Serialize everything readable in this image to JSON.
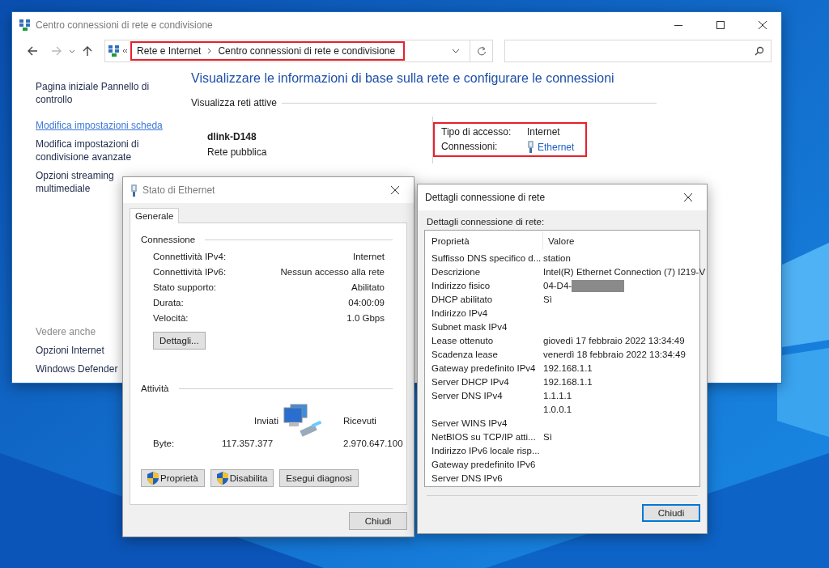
{
  "main_window": {
    "title": "Centro connessioni di rete e condivisione",
    "address": {
      "breadcrumb": [
        "Rete e Internet",
        "Centro connessioni di rete e condivisione"
      ],
      "highlighted": true
    },
    "sidebar": {
      "links": [
        {
          "label": "Pagina iniziale Pannello di controllo",
          "hovered": false
        },
        {
          "label": "Modifica impostazioni scheda",
          "hovered": true
        },
        {
          "label": "Modifica impostazioni di condivisione avanzate",
          "hovered": false
        },
        {
          "label": "Opzioni streaming multimediale",
          "hovered": false
        }
      ],
      "see_also": {
        "heading": "Vedere anche",
        "links": [
          "Opzioni Internet",
          "Windows Defender"
        ]
      }
    },
    "heading": "Visualizzare le informazioni di base sulla rete e configurare le connessioni",
    "section": "Visualizza reti attive",
    "network": {
      "name": "dlink-D148",
      "type": "Rete pubblica"
    },
    "access": {
      "highlighted": true,
      "rows": [
        {
          "label": "Tipo di accesso:",
          "value": "Internet",
          "kind": "text"
        },
        {
          "label": "Connessioni:",
          "value": "Ethernet",
          "kind": "link"
        }
      ]
    }
  },
  "status_dialog": {
    "title": "Stato di Ethernet",
    "tabs": [
      {
        "label": "Generale",
        "selected": true
      }
    ],
    "connection": {
      "heading": "Connessione",
      "rows": [
        {
          "label": "Connettività IPv4:",
          "value": "Internet"
        },
        {
          "label": "Connettività IPv6:",
          "value": "Nessun accesso alla rete"
        },
        {
          "label": "Stato supporto:",
          "value": "Abilitato"
        },
        {
          "label": "Durata:",
          "value": "04:00:09"
        },
        {
          "label": "Velocità:",
          "value": "1.0 Gbps"
        }
      ],
      "details_button": "Dettagli..."
    },
    "activity": {
      "heading": "Attività",
      "sent_label": "Inviati",
      "received_label": "Ricevuti",
      "bytes_label": "Byte:",
      "sent": "117.357.377",
      "received": "2.970.647.100"
    },
    "buttons": [
      {
        "label": "Proprietà",
        "shield": true
      },
      {
        "label": "Disabilita",
        "shield": true
      },
      {
        "label": "Esegui diagnosi",
        "shield": false
      }
    ],
    "close_button": {
      "label": "Chiudi",
      "focused": false
    }
  },
  "details_dialog": {
    "title": "Dettagli connessione di rete",
    "caption": "Dettagli connessione di rete:",
    "columns": [
      "Proprietà",
      "Valore"
    ],
    "rows": [
      {
        "property": "Suffisso DNS specifico d...",
        "value": "station",
        "redacted": false
      },
      {
        "property": "Descrizione",
        "value": "Intel(R) Ethernet Connection (7) I219-V",
        "redacted": false
      },
      {
        "property": "Indirizzo fisico",
        "value": "04-D4-",
        "redacted": true
      },
      {
        "property": "DHCP abilitato",
        "value": "Sì",
        "redacted": false
      },
      {
        "property": "Indirizzo IPv4",
        "redacted": false
      },
      {
        "property": "Subnet mask IPv4",
        "redacted": false
      },
      {
        "property": "Lease ottenuto",
        "value": "giovedì 17 febbraio 2022 13:34:49",
        "redacted": false
      },
      {
        "property": "Scadenza lease",
        "value": "venerdì 18 febbraio 2022 13:34:49",
        "redacted": false
      },
      {
        "property": "Gateway predefinito IPv4",
        "value": "192.168.1.1",
        "redacted": false
      },
      {
        "property": "Server DHCP IPv4",
        "value": "192.168.1.1",
        "redacted": false
      },
      {
        "property": "Server DNS IPv4",
        "value": "1.1.1.1",
        "redacted": false
      },
      {
        "value": "1.0.0.1",
        "redacted": false
      },
      {
        "property": "Server WINS IPv4",
        "redacted": false
      },
      {
        "property": "NetBIOS su TCP/IP atti...",
        "value": "Sì",
        "redacted": false
      },
      {
        "property": "Indirizzo IPv6 locale risp...",
        "redacted": false
      },
      {
        "property": "Gateway predefinito IPv6",
        "redacted": false
      },
      {
        "property": "Server DNS IPv6",
        "redacted": false
      }
    ],
    "close_button": {
      "label": "Chiudi",
      "focused": true
    }
  }
}
